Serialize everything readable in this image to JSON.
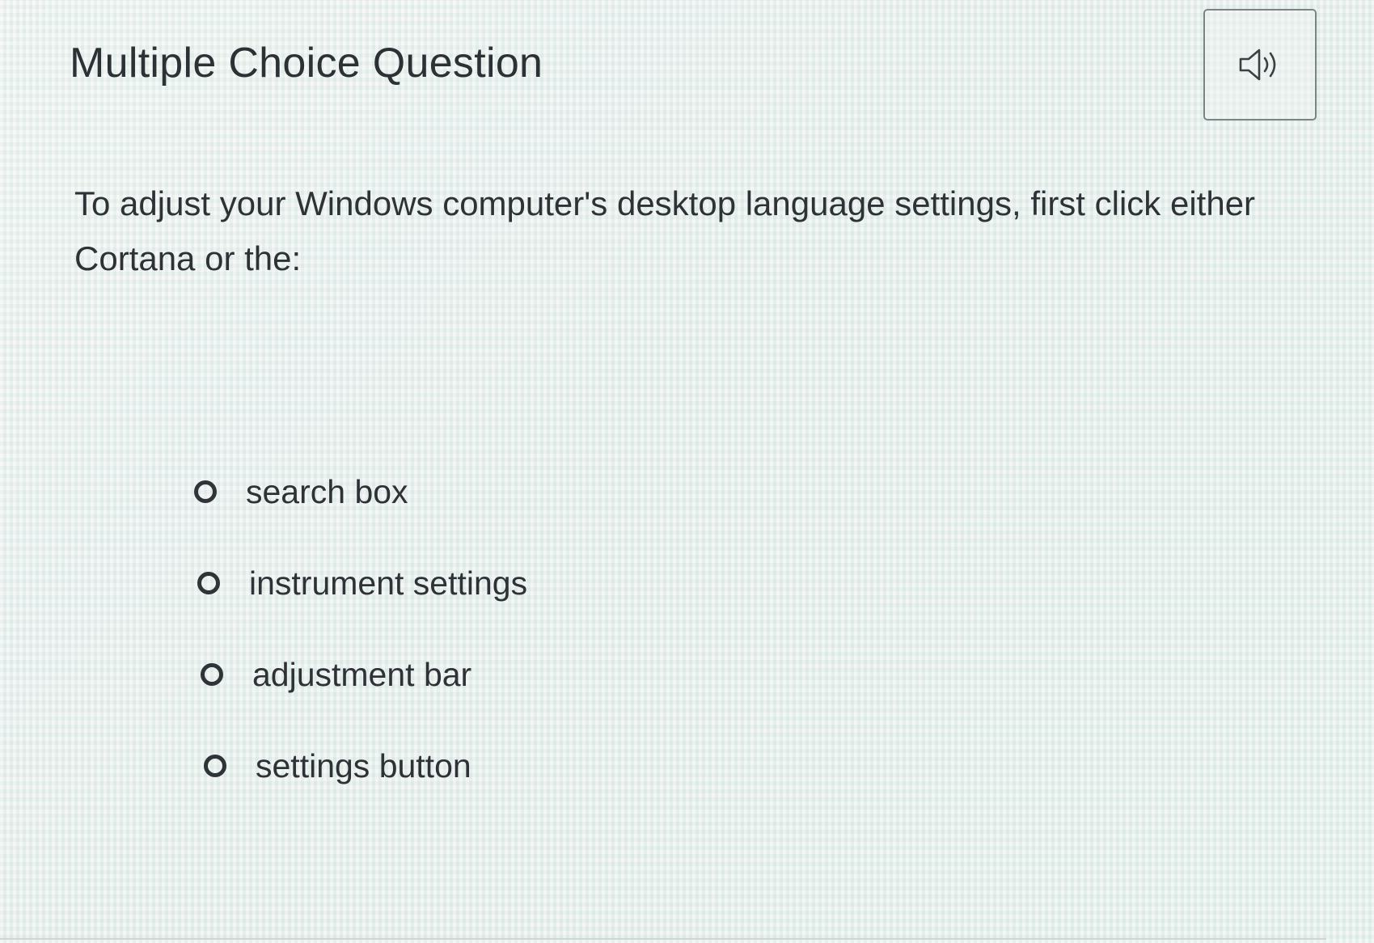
{
  "header": {
    "title": "Multiple Choice Question",
    "audio_icon": "speaker-volume-icon"
  },
  "question": {
    "text": "To adjust your Windows computer's desktop language settings, first click either Cortana or the:"
  },
  "options": [
    {
      "label": "search box",
      "selected": false
    },
    {
      "label": "instrument settings",
      "selected": false
    },
    {
      "label": "adjustment bar",
      "selected": false
    },
    {
      "label": "settings button",
      "selected": false
    }
  ],
  "colors": {
    "text": "#2e3236",
    "border": "#7c8387",
    "background": "#e8ecea"
  }
}
